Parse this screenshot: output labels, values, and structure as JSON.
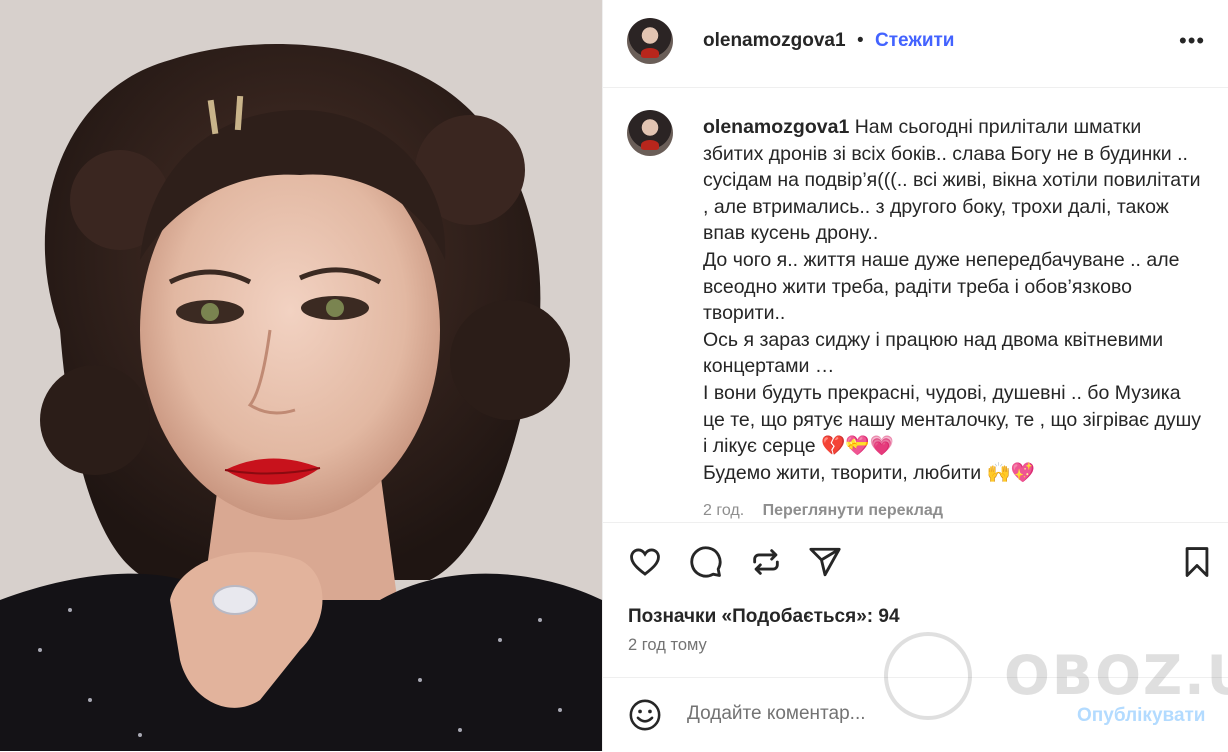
{
  "post": {
    "username": "olenamozgova1",
    "follow_label": "Стежити",
    "separator": "•",
    "more_label": "•••"
  },
  "caption": {
    "username": "olenamozgova1",
    "lines": [
      "Нам сьогодні прилітали шматки збитих дронів зі всіх боків.. слава Богу не в будинки .. сусідам на подвір’я(((.. всі живі, вікна хотіли повилітати , але втримались.. з другого боку, трохи далі, також впав кусень дрону..",
      "До чого я.. життя наше дуже непередбачуване .. але всеодно жити треба, радіти треба і обов’язково творити..",
      "Ось я зараз сиджу і працюю над двома квітневими концертами …",
      "І вони будуть прекрасні, чудові, душевні .. бо Музика це те, що рятує нашу менталочку, те , що зігріває душу і лікує серце 💔💝💗",
      "Будемо жити, творити, любити 🙌💖"
    ],
    "age": "2 год.",
    "translate_label": "Переглянути переклад"
  },
  "actions": {
    "like_icon": "heart-icon",
    "comment_icon": "comment-icon",
    "repost_icon": "repost-icon",
    "share_icon": "send-icon",
    "save_icon": "bookmark-icon"
  },
  "stats": {
    "likes_text": "Позначки «Подобається»: 94",
    "time_ago": "2 год тому"
  },
  "comment": {
    "placeholder": "Додайте коментар...",
    "post_label": "Опублікувати",
    "emoji_icon": "smiley-icon"
  },
  "watermark": {
    "text": "OBOZ.UA"
  },
  "colors": {
    "accent": "#4363ff",
    "post_disabled": "#b3dbff",
    "muted": "#737373"
  }
}
